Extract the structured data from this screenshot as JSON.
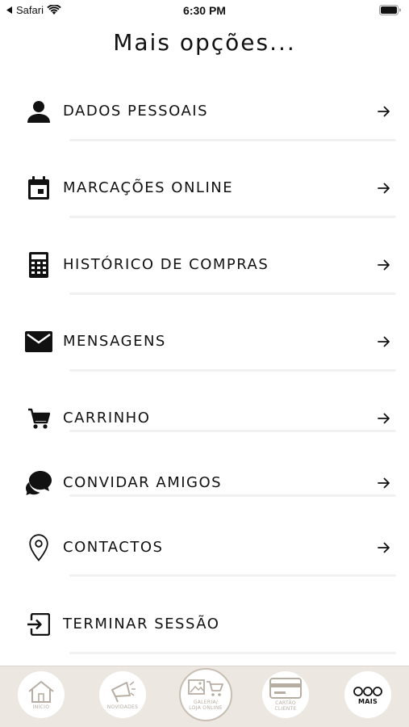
{
  "status": {
    "back_app": "Safari",
    "time": "6:30 PM"
  },
  "header": {
    "title": "Mais opções..."
  },
  "menu": [
    {
      "label": "DADOS PESSOAIS",
      "icon": "person-icon"
    },
    {
      "label": "MARCAÇÕES ONLINE",
      "icon": "calendar-icon"
    },
    {
      "label": "HISTÓRICO DE COMPRAS",
      "icon": "calculator-icon"
    },
    {
      "label": "MENSAGENS",
      "icon": "envelope-icon"
    },
    {
      "label": "CARRINHO",
      "icon": "cart-icon"
    },
    {
      "label": "CONVIDAR AMIGOS",
      "icon": "chat-bubbles-icon"
    },
    {
      "label": "CONTACTOS",
      "icon": "location-pin-icon"
    },
    {
      "label": "TERMINAR SESSÃO",
      "icon": "logout-icon"
    }
  ],
  "tabbar": {
    "tabs": [
      {
        "label": "INÍCIO",
        "icon": "home-icon"
      },
      {
        "label": "NOVIDADES",
        "icon": "megaphone-icon"
      },
      {
        "label_line1": "GALERIA/",
        "label_line2": "LOJA ONLINE",
        "icon": "gallery-cart-icon"
      },
      {
        "label_line1": "CARTÃO",
        "label_line2": "CLIENTE",
        "icon": "card-icon"
      },
      {
        "label": "MAIS",
        "icon": "more-dots-icon"
      }
    ]
  },
  "colors": {
    "tabbar_bg": "#ece8e1",
    "tab_inactive": "#b7aea3",
    "text": "#111111"
  }
}
